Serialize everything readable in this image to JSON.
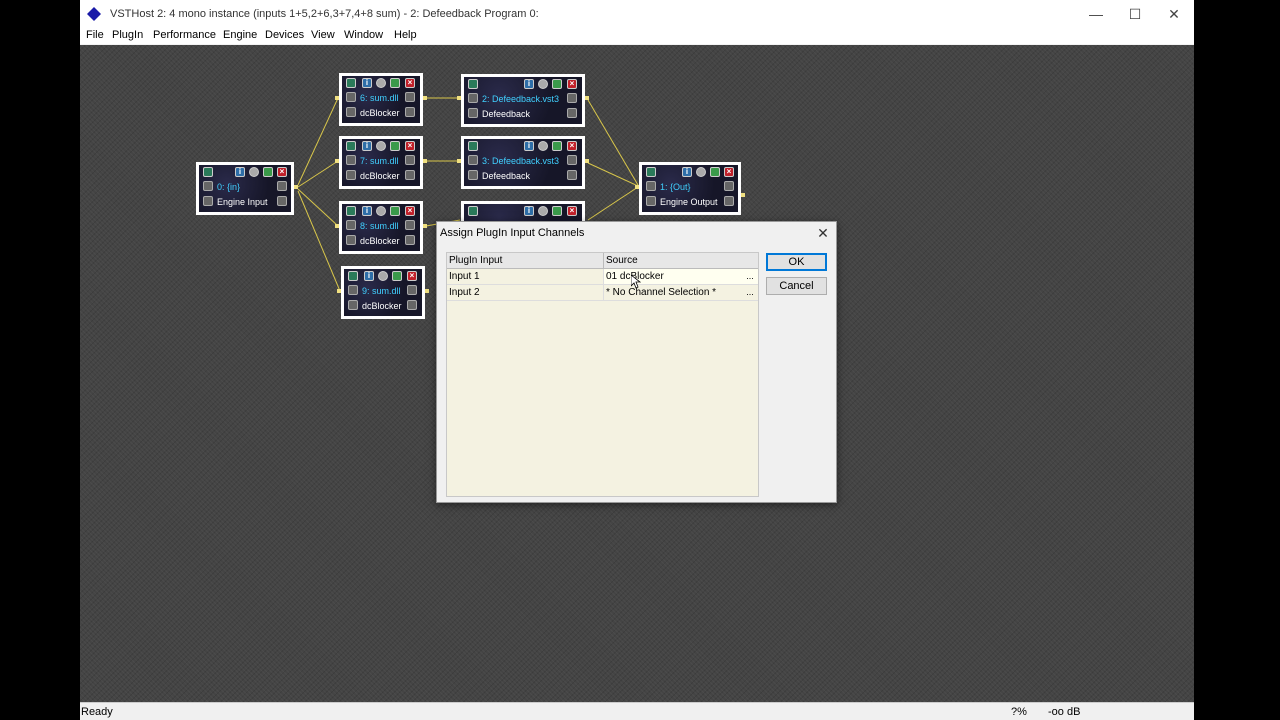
{
  "window": {
    "title": "VSTHost 2: 4 mono instance (inputs 1+5,2+6,3+7,4+8 sum) - 2: Defeedback Program 0:",
    "minimize_glyph": "—",
    "maximize_glyph": "☐",
    "close_glyph": "✕"
  },
  "menu": [
    "File",
    "PlugIn",
    "Performance",
    "Engine",
    "Devices",
    "View",
    "Window",
    "Help"
  ],
  "nodes": {
    "in": {
      "name": "0: {in}",
      "label": "Engine Input"
    },
    "sum6": {
      "name": "6: sum.dll",
      "label": "dcBlocker"
    },
    "sum7": {
      "name": "7: sum.dll",
      "label": "dcBlocker"
    },
    "sum8": {
      "name": "8: sum.dll",
      "label": "dcBlocker"
    },
    "sum9": {
      "name": "9: sum.dll",
      "label": "dcBlocker"
    },
    "def2": {
      "name": "2: Defeedback.vst3",
      "label": "Defeedback"
    },
    "def3": {
      "name": "3: Defeedback.vst3",
      "label": "Defeedback"
    },
    "out": {
      "name": "1: {Out}",
      "label": "Engine Output"
    }
  },
  "node_buttons": {
    "info": "i",
    "close": "×"
  },
  "dialog": {
    "title": "Assign PlugIn Input Channels",
    "close_glyph": "✕",
    "headers": {
      "input": "PlugIn Input",
      "source": "Source"
    },
    "rows": [
      {
        "input": "Input 1",
        "source": "01 dcBlocker"
      },
      {
        "input": "Input 2",
        "source": "* No Channel Selection *"
      }
    ],
    "ellipsis": "...",
    "ok_label": "OK",
    "cancel_label": "Cancel"
  },
  "status": {
    "left": "Ready",
    "percent": "?%",
    "level": "-oo dB"
  },
  "colors": {
    "wire": "#d8c64a",
    "node_bg": "#161628",
    "name_text": "#40d0ff",
    "label_text": "#ffffff",
    "accent_ok": "#0078d7"
  }
}
